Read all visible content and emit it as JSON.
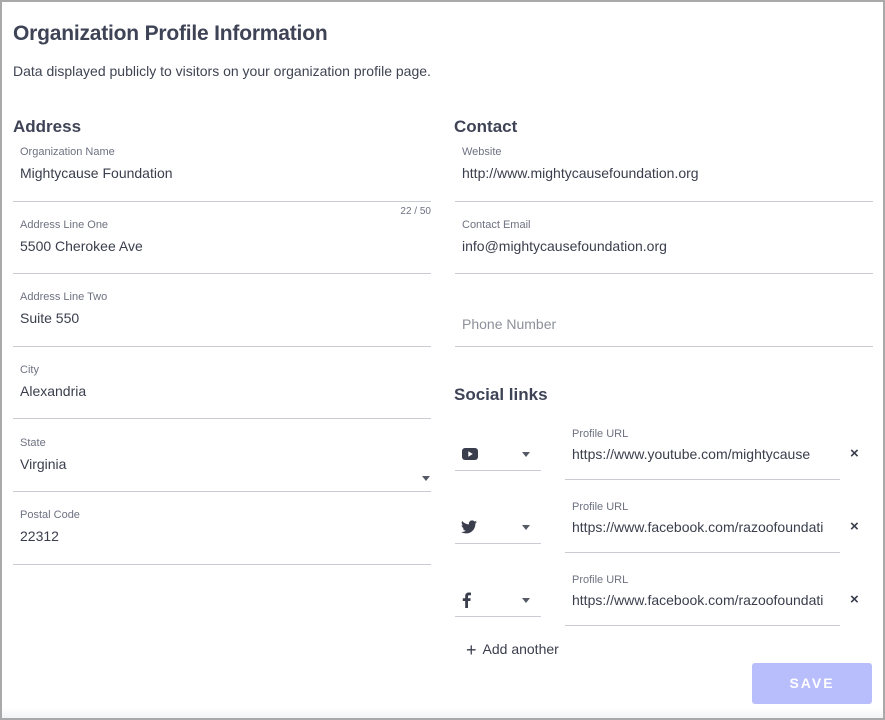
{
  "header": {
    "title": "Organization Profile Information",
    "subtitle": "Data displayed publicly to visitors on your organization profile page."
  },
  "address": {
    "heading": "Address",
    "org_name": {
      "label": "Organization Name",
      "value": "Mightycause Foundation",
      "counter": "22 / 50"
    },
    "line_one": {
      "label": "Address Line One",
      "value": "5500 Cherokee Ave"
    },
    "line_two": {
      "label": "Address Line Two",
      "value": "Suite 550"
    },
    "city": {
      "label": "City",
      "value": "Alexandria"
    },
    "state": {
      "label": "State",
      "value": "Virginia"
    },
    "postal": {
      "label": "Postal Code",
      "value": "22312"
    }
  },
  "contact": {
    "heading": "Contact",
    "website": {
      "label": "Website",
      "value": "http://www.mightycausefoundation.org"
    },
    "email": {
      "label": "Contact Email",
      "value": "info@mightycausefoundation.org"
    },
    "phone": {
      "placeholder": "Phone Number"
    }
  },
  "social": {
    "heading": "Social links",
    "links": [
      {
        "icon": "youtube-icon",
        "label": "Profile URL",
        "value": "https://www.youtube.com/mightycause",
        "remove": "×"
      },
      {
        "icon": "twitter-icon",
        "label": "Profile URL",
        "value": "https://www.facebook.com/razoofoundati",
        "remove": "×"
      },
      {
        "icon": "facebook-icon",
        "label": "Profile URL",
        "value": "https://www.facebook.com/razoofoundati",
        "remove": "×"
      }
    ],
    "add_another": "Add another",
    "add_icon": "+"
  },
  "actions": {
    "save_label": "SAVE"
  },
  "colors": {
    "save_bg": "#b8bdfb",
    "heading": "#3e4356",
    "border": "#c9ccd3"
  }
}
